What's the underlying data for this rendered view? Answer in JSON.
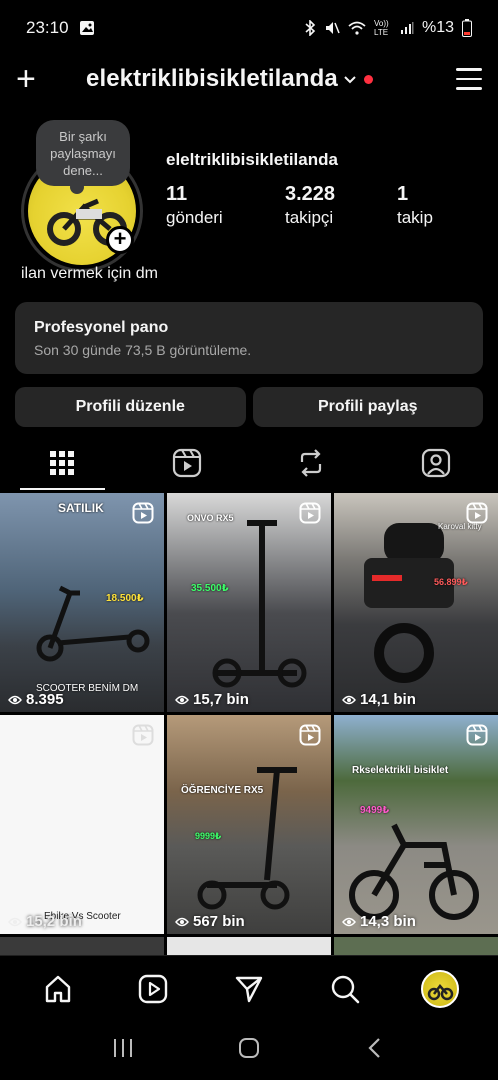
{
  "status_bar": {
    "time": "23:10",
    "battery": "%13",
    "network_label": "Vo)) LTE"
  },
  "header": {
    "username": "elektriklibisikletilanda",
    "plus_icon": "plus-icon",
    "menu_icon": "hamburger-menu-icon",
    "notification_dot_color": "#ff3040"
  },
  "profile": {
    "note_text": "Bir şarkı paylaşmayı dene...",
    "name": "eleltriklibisikletilanda",
    "stats": [
      {
        "value": "11",
        "label": "gönderi"
      },
      {
        "value": "3.228",
        "label": "takipçi"
      },
      {
        "value": "1",
        "label": "takip"
      }
    ],
    "bio": "ilan vermek için dm"
  },
  "pro_panel": {
    "title": "Profesyonel pano",
    "subtitle": "Son 30 günde 73,5 B görüntüleme."
  },
  "buttons": {
    "edit_profile": "Profili düzenle",
    "share_profile": "Profili paylaş"
  },
  "tabs": [
    "grid-icon",
    "reels-icon",
    "reposts-icon",
    "tagged-icon"
  ],
  "posts": [
    {
      "views": "8.395",
      "overlay_top": "SATILIK",
      "overlay_bottom": "SCOOTER BENİM DM",
      "price": "18.500₺",
      "bg": "#5b6c80"
    },
    {
      "views": "15,7 bin",
      "overlay_top": "ONVO RX5",
      "price": "35.500₺",
      "bg": "#3d3f44"
    },
    {
      "views": "14,1 bin",
      "overlay_top": "Karoval kitty",
      "price": "56.899₺",
      "bg": "#4a4c50"
    },
    {
      "views": "15,2 bin",
      "overlay_mid": "Ebike Vs Scooter",
      "bg": "#f6f6f6"
    },
    {
      "views": "567 bin",
      "overlay_top": "ÖĞRENCİYE RX5",
      "price": "9999₺",
      "bg": "#6b5a45"
    },
    {
      "views": "14,3 bin",
      "overlay_top": "Rkselektrikli bisiklet",
      "price": "9499₺",
      "bg": "#6d7b64"
    }
  ],
  "bottom_nav": [
    "home-icon",
    "reels-icon",
    "send-icon",
    "search-icon",
    "profile-avatar"
  ],
  "system_nav": [
    "recents-icon",
    "home-circle-icon",
    "back-icon"
  ]
}
